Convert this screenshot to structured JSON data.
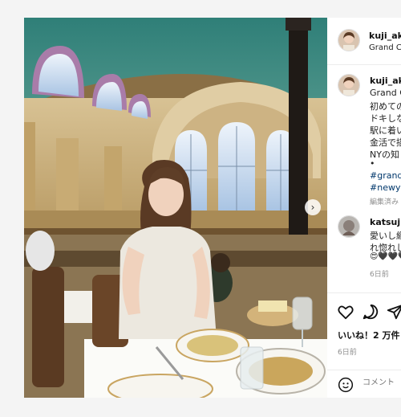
{
  "post": {
    "username": "kuji_aki",
    "location": "Grand Ce",
    "caption_username": "kuji_ak",
    "caption_lines": [
      "Grand C",
      "初めての",
      "ドキしな",
      "駅に着い",
      "金活で描",
      "NYの知",
      "•"
    ],
    "hashtags": [
      "#grande",
      "#newyo"
    ],
    "edited_label": "編集済み",
    "likes": "いいね！2 万件",
    "date": "6日前"
  },
  "comment": {
    "username": "katsujii",
    "lines": [
      "愛いし網",
      "れ惚れし"
    ],
    "emoji_line": "😍🖤🖤🖤",
    "time": "6日前"
  },
  "composer": {
    "placeholder": "コメント"
  },
  "icons": {
    "next": "chevron-right-icon",
    "like": "heart-icon",
    "comment": "comment-icon",
    "share": "share-icon",
    "emoji": "emoji-icon"
  }
}
